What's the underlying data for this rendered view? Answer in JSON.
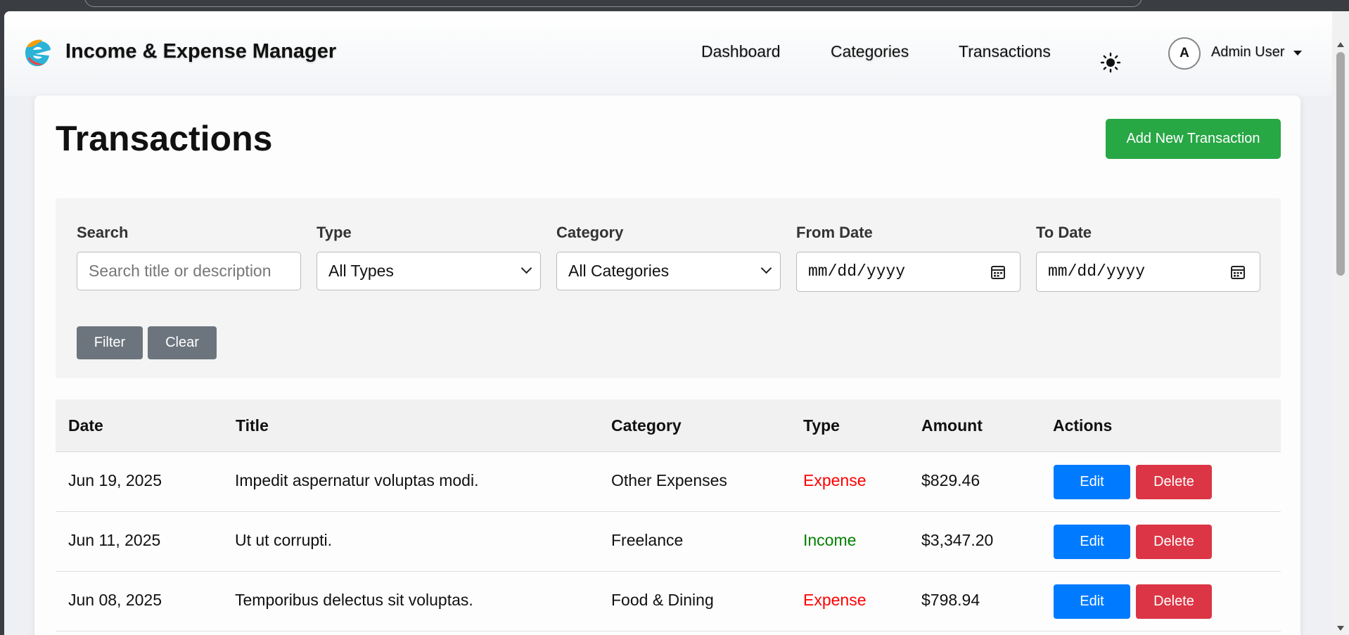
{
  "app": {
    "title": "Income & Expense Manager"
  },
  "nav": {
    "links": [
      "Dashboard",
      "Categories",
      "Transactions"
    ],
    "theme_icon": "sun-icon",
    "user": {
      "initial": "A",
      "name": "Admin User"
    }
  },
  "page": {
    "title": "Transactions",
    "add_button": "Add New Transaction"
  },
  "filters": {
    "search": {
      "label": "Search",
      "placeholder": "Search title or description",
      "value": ""
    },
    "type": {
      "label": "Type",
      "selected": "All Types"
    },
    "category": {
      "label": "Category",
      "selected": "All Categories"
    },
    "from_date": {
      "label": "From Date",
      "value": "mm/dd/yyyy"
    },
    "to_date": {
      "label": "To Date",
      "value": "mm/dd/yyyy"
    },
    "filter_button": "Filter",
    "clear_button": "Clear"
  },
  "table": {
    "headers": [
      "Date",
      "Title",
      "Category",
      "Type",
      "Amount",
      "Actions"
    ],
    "edit_label": "Edit",
    "delete_label": "Delete",
    "rows": [
      {
        "date": "Jun 19, 2025",
        "title": "Impedit aspernatur voluptas modi.",
        "category": "Other Expenses",
        "type": "Expense",
        "amount": "$829.46"
      },
      {
        "date": "Jun 11, 2025",
        "title": "Ut ut corrupti.",
        "category": "Freelance",
        "type": "Income",
        "amount": "$3,347.20"
      },
      {
        "date": "Jun 08, 2025",
        "title": "Temporibus delectus sit voluptas.",
        "category": "Food & Dining",
        "type": "Expense",
        "amount": "$798.94"
      }
    ]
  },
  "colors": {
    "success": "#28a745",
    "primary": "#007bff",
    "danger": "#dc3545",
    "secondary": "#6c757d",
    "income_text": "#008000",
    "expense_text": "#ff0000"
  }
}
